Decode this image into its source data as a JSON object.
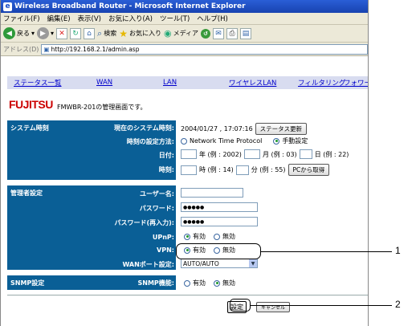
{
  "window": {
    "title": "Wireless Broadband Router - Microsoft Internet Explorer"
  },
  "menu": [
    "ファイル(F)",
    "編集(E)",
    "表示(V)",
    "お気に入り(A)",
    "ツール(T)",
    "ヘルプ(H)"
  ],
  "toolbar": {
    "back": "戻る",
    "search": "検索",
    "favorites": "お気に入り",
    "media": "メディア"
  },
  "address": {
    "label": "アドレス(D)",
    "url": "http://192.168.2.1/admin.asp"
  },
  "nav": [
    "ステータス一覧",
    "WAN",
    "LAN",
    "ワイヤレスLAN",
    "フィルタリング",
    "フォワー"
  ],
  "brand": {
    "logo": "FUJITSU",
    "welcome": "FMWBR-201の管理画面です。"
  },
  "system_time": {
    "header": "システム時刻",
    "current_label": "現在のシステム時刻:",
    "current_value": "2004/01/27 , 17:07:16",
    "status_update_button": "ステータス更新",
    "method_label": "時刻の設定方法:",
    "method_ntp": "Network Time Protocol",
    "method_manual": "手動設定",
    "date_label": "日付:",
    "year_hint": "年 (例 : 2002)",
    "month_hint": "月 (例 : 03)",
    "day_hint": "日 (例 : 22)",
    "time_label": "時刻:",
    "hour_hint": "時 (例 : 14)",
    "minute_hint": "分 (例 : 55)",
    "pc_button": "PCから取得"
  },
  "admin": {
    "header": "管理者設定",
    "user_label": "ユーザー名:",
    "user_value": "",
    "password_label": "パスワード:",
    "password_value": "●●●●●",
    "password_confirm_label": "パスワード(再入力):",
    "password_confirm_value": "●●●●●",
    "upnp_label": "UPnP:",
    "vpn_label": "VPN:",
    "enable": "有効",
    "disable": "無効",
    "wanport_label": "WANポート設定:",
    "wanport_value": "AUTO/AUTO"
  },
  "snmp": {
    "header": "SNMP設定",
    "func_label": "SNMP機能:",
    "enable": "有効",
    "disable": "無効"
  },
  "footer": {
    "apply_button": "設定",
    "cancel_button": "キャンセル"
  },
  "callouts": {
    "one": "1",
    "two": "2"
  },
  "colors": {
    "section_header": "#0a5f96",
    "nav_bg": "#d8dcf0",
    "title_bar": "#1b4fc8"
  }
}
